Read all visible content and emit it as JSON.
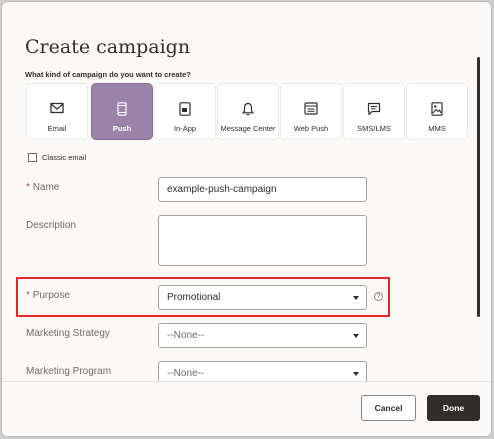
{
  "dialog": {
    "title": "Create campaign",
    "question": "What kind of campaign do you want to create?"
  },
  "campaign_types": [
    {
      "label": "Email",
      "icon": "envelope-icon",
      "selected": false
    },
    {
      "label": "Push",
      "icon": "mobile-phone-icon",
      "selected": true
    },
    {
      "label": "In-App",
      "icon": "in-app-message-icon",
      "selected": false
    },
    {
      "label": "Message Center",
      "icon": "bell-icon",
      "selected": false
    },
    {
      "label": "Web Push",
      "icon": "browser-window-icon",
      "selected": false
    },
    {
      "label": "SMS/LMS",
      "icon": "chat-bubble-icon",
      "selected": false
    },
    {
      "label": "MMS",
      "icon": "image-icon",
      "selected": false
    }
  ],
  "classic_email": {
    "label": "Classic email",
    "checked": false
  },
  "form": {
    "name": {
      "required_mark": "*",
      "label": "Name",
      "value": "example-push-campaign"
    },
    "description": {
      "label": "Description",
      "value": ""
    },
    "purpose": {
      "required_mark": "*",
      "label": "Purpose",
      "value": "Promotional",
      "help": "?"
    },
    "marketing_strategy": {
      "label": "Marketing Strategy",
      "value": "--None--"
    },
    "marketing_program": {
      "label": "Marketing Program",
      "value": "--None--"
    }
  },
  "footer": {
    "cancel_label": "Cancel",
    "done_label": "Done"
  },
  "colors": {
    "selected_tile": "#9b82a8",
    "highlight": "#e5262b",
    "done_button": "#312d2a"
  }
}
